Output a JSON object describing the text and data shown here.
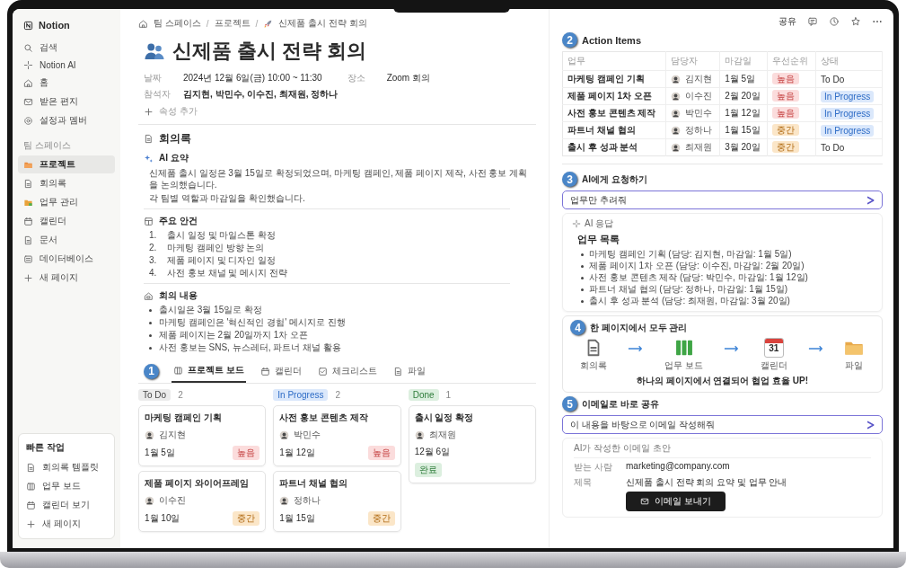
{
  "sidebar": {
    "brand": "Notion",
    "top_items": [
      {
        "label": "검색"
      },
      {
        "label": "Notion AI"
      },
      {
        "label": "홈"
      },
      {
        "label": "받은 편지"
      },
      {
        "label": "설정과 멤버"
      }
    ],
    "section_title": "팀 스페이스",
    "items": [
      {
        "label": "프로젝트",
        "selected": true
      },
      {
        "label": "회의록",
        "selected": false
      },
      {
        "label": "업무 관리",
        "selected": false
      },
      {
        "label": "캘린더",
        "selected": false
      },
      {
        "label": "문서",
        "selected": false
      },
      {
        "label": "데이터베이스",
        "selected": false
      },
      {
        "label": "새 페이지",
        "selected": false
      }
    ],
    "quick": {
      "title": "빠른 작업",
      "items": [
        "회의록 템플릿",
        "업무 보드",
        "캘린더 보기",
        "새 페이지"
      ]
    }
  },
  "breadcrumb": {
    "items": [
      "팀 스페이스",
      "프로젝트",
      "신제품 출시 전략 회의"
    ],
    "separators": [
      "/",
      "/"
    ]
  },
  "header_actions": {
    "share": "공유"
  },
  "page": {
    "title": "신제품 출시 전략 회의",
    "property_rows": [
      [
        {
          "label": "날짜",
          "value": "2024년 12월 6일(금) 10:00 ~ 11:30"
        },
        {
          "label": "장소",
          "value": "Zoom 회의"
        }
      ],
      [
        {
          "label": "참석자",
          "value": "김지현, 박민수, 이수진, 최재원, 정하나"
        }
      ]
    ],
    "add_property": "속성 추가"
  },
  "notes": {
    "title": "회의록",
    "ai_summary": {
      "title": "AI 요약",
      "lines": [
        "신제품 출시 일정은 3월 15일로 확정되었으며, 마케팅 캠페인, 제품 페이지 제작, 사전 홍보 계획을 논의했습니다.",
        "각 팀별 역할과 마감일을 확인했습니다."
      ]
    },
    "agenda": {
      "title": "주요 안건",
      "items": [
        {
          "number": "1.",
          "text": "출시 일정 및 마일스톤 확정"
        },
        {
          "number": "2.",
          "text": "마케팅 캠페인 방향 논의"
        },
        {
          "number": "3.",
          "text": "제품 페이지 및 디자인 일정"
        },
        {
          "number": "4.",
          "text": "사전 홍보 채널 및 메시지 전략"
        }
      ]
    },
    "content": {
      "title": "회의 내용",
      "items": [
        "출시일은 3월 15일로 확정",
        "마케팅 캠페인은 '혁신적인 경험' 메시지로 진행",
        "제품 페이지는 2월 20일까지 1차 오픈",
        "사전 홍보는 SNS, 뉴스레터, 파트너 채널 활용"
      ]
    }
  },
  "board": {
    "badge": "1",
    "tabs": [
      {
        "label": "프로젝트 보드",
        "selected": true
      },
      {
        "label": "캘린더",
        "selected": false
      },
      {
        "label": "체크리스트",
        "selected": false
      },
      {
        "label": "파일",
        "selected": false
      }
    ],
    "columns": [
      {
        "title": "To Do",
        "kind": "todo",
        "count": "2",
        "cards": [
          {
            "title": "마케팅 캠페인 기획",
            "assignee": "김지현",
            "date": "1월 5일",
            "tag": {
              "text": "높음",
              "kind": "high"
            }
          },
          {
            "title": "제품 페이지 와이어프레임",
            "assignee": "이수진",
            "date": "1월 10일",
            "tag": {
              "text": "중간",
              "kind": "medium"
            }
          }
        ]
      },
      {
        "title": "In Progress",
        "kind": "progress",
        "count": "2",
        "cards": [
          {
            "title": "사전 홍보 콘텐츠 제작",
            "assignee": "박민수",
            "date": "1월 12일",
            "tag": {
              "text": "높음",
              "kind": "high"
            }
          },
          {
            "title": "파트너 채널 협의",
            "assignee": "정하나",
            "date": "1월 15일",
            "tag": {
              "text": "중간",
              "kind": "medium"
            }
          }
        ]
      },
      {
        "title": "Done",
        "kind": "done",
        "count": "1",
        "cards": [
          {
            "title": "출시 일정 확정",
            "assignee": "최재원",
            "date": "12월 6일",
            "tag": {
              "text": "완료",
              "kind": "done"
            }
          }
        ]
      }
    ]
  },
  "action_items": {
    "badge": "2",
    "title": "Action Items",
    "columns": [
      "업무",
      "담당자",
      "마감일",
      "우선순위",
      "상태"
    ],
    "rows": [
      {
        "task": "마케팅 캠페인 기획",
        "assignee": "김지현",
        "due": "1월 5일",
        "priority": {
          "text": "높음",
          "kind": "high"
        },
        "status": {
          "text": "To Do",
          "kind": "todo"
        }
      },
      {
        "task": "제품 페이지 1차 오픈",
        "assignee": "이수진",
        "due": "2월 20일",
        "priority": {
          "text": "높음",
          "kind": "high"
        },
        "status": {
          "text": "In Progress",
          "kind": "progress"
        }
      },
      {
        "task": "사전 홍보 콘텐츠 제작",
        "assignee": "박민수",
        "due": "1월 12일",
        "priority": {
          "text": "높음",
          "kind": "high"
        },
        "status": {
          "text": "In Progress",
          "kind": "progress"
        }
      },
      {
        "task": "파트너 채널 협의",
        "assignee": "정하나",
        "due": "1월 15일",
        "priority": {
          "text": "중간",
          "kind": "medium"
        },
        "status": {
          "text": "In Progress",
          "kind": "progress"
        }
      },
      {
        "task": "출시 후 성과 분석",
        "assignee": "최재원",
        "due": "3월 20일",
        "priority": {
          "text": "중간",
          "kind": "medium"
        },
        "status": {
          "text": "To Do",
          "kind": "todo"
        }
      }
    ]
  },
  "ai_request": {
    "badge": "3",
    "title": "AI에게 요청하기",
    "value": "업무만 추려줘"
  },
  "ai_response": {
    "label": "AI 응답",
    "title": "업무 목록",
    "items": [
      "마케팅 캠페인 기획 (담당: 김지현, 마감일: 1월 5일)",
      "제품 페이지 1차 오픈 (담당: 이수진, 마감일: 2월 20일)",
      "사전 홍보 콘텐츠 제작 (담당: 박민수, 마감일: 1월 12일)",
      "파트너 채널 협의 (담당: 정하나, 마감일: 1월 15일)",
      "출시 후 성과 분석 (담당: 최재원, 마감일: 3월 20일)"
    ]
  },
  "flow": {
    "badge": "4",
    "title": "한 페이지에서 모두 관리",
    "steps": [
      {
        "label": "회의록"
      },
      {
        "label": "업무 보드"
      },
      {
        "label": "캘린더",
        "day": "31"
      },
      {
        "label": "파일"
      }
    ],
    "caption": "하나의 페이지에서 연결되어 협업 효율 UP!"
  },
  "email": {
    "badge": "5",
    "title": "이메일로 바로 공유",
    "value": "이 내용을 바탕으로 이메일 작성해줘",
    "draft_title": "AI가 작성한 이메일 초안",
    "fields": [
      {
        "label": "받는 사람",
        "value": "marketing@company.com"
      },
      {
        "label": "제목",
        "value": "신제품 출시 전략 회의 요약 및 업무 안내"
      }
    ],
    "send_button": "이메일 보내기"
  }
}
